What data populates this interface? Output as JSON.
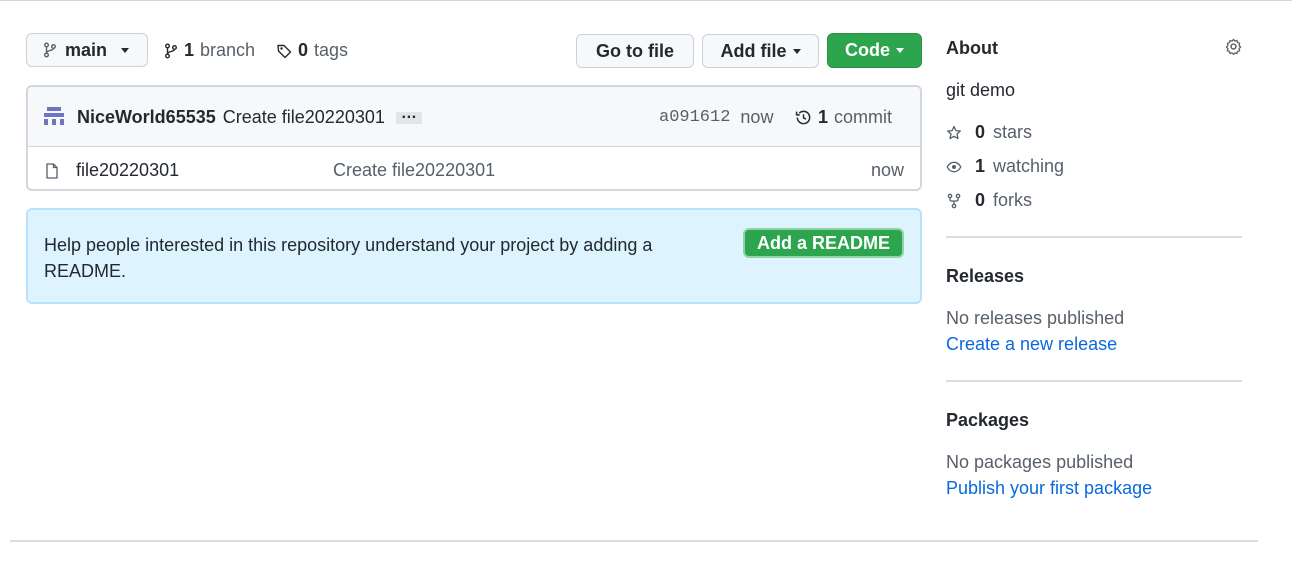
{
  "branch_selector": {
    "label": "main"
  },
  "branches": {
    "count": "1",
    "label": "branch"
  },
  "tags": {
    "count": "0",
    "label": "tags"
  },
  "buttons": {
    "go_to_file": "Go to file",
    "add_file": "Add file",
    "code": "Code"
  },
  "latest_commit": {
    "author": "NiceWorld65535",
    "message": "Create file20220301",
    "more": "…",
    "sha": "a091612",
    "time": "now",
    "commit_count": "1",
    "commit_label": "commit"
  },
  "files": [
    {
      "name": "file20220301",
      "message": "Create file20220301",
      "time": "now"
    }
  ],
  "readme_prompt": {
    "text": "Help people interested in this repository understand your project by adding a README.",
    "button": "Add a README"
  },
  "about": {
    "heading": "About",
    "description": "git demo",
    "stars": {
      "count": "0",
      "label": "stars"
    },
    "watching": {
      "count": "1",
      "label": "watching"
    },
    "forks": {
      "count": "0",
      "label": "forks"
    }
  },
  "releases": {
    "heading": "Releases",
    "status": "No releases published",
    "link": "Create a new release"
  },
  "packages": {
    "heading": "Packages",
    "status": "No packages published",
    "link": "Publish your first package"
  },
  "colors": {
    "green": "#2da44e",
    "link": "#0969da",
    "info_bg": "#ddf4ff"
  },
  "icons": [
    "git-branch-icon",
    "tag-icon",
    "history-icon",
    "file-icon",
    "gear-icon",
    "star-icon",
    "eye-icon",
    "repo-forked-icon",
    "avatar-identicon"
  ]
}
